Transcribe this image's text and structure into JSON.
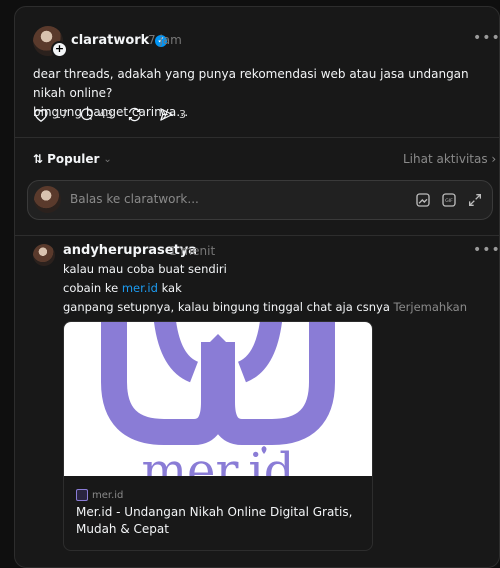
{
  "post": {
    "username": "claratwork",
    "time": "7 jam",
    "text_line1": "dear threads, adakah yang punya rekomendasi web atau jasa undangan nikah online?",
    "text_line2": "bingung banget carinya…",
    "likes": "17",
    "comments": "43",
    "shares": "3"
  },
  "sort": {
    "label": "Populer",
    "activity": "Lihat aktivitas"
  },
  "reply_box": {
    "placeholder": "Balas ke claratwork..."
  },
  "reply": {
    "username": "andyheruprasetya",
    "time": "1 menit",
    "line1": "kalau mau coba buat sendiri",
    "line2_prefix": "cobain ke ",
    "line2_link": "mer.id",
    "line2_suffix": " kak",
    "line3": "ganpang setupnya, kalau bingung tinggal chat aja csnya",
    "translate": "Terjemahkan",
    "card": {
      "domain": "mer.id",
      "title": "Mer.id - Undangan Nikah Online Digital Gratis, Mudah & Cepat",
      "image_text": "mer.id"
    }
  },
  "colors": {
    "background": "#0f0f0f",
    "panel": "#181818",
    "link": "#1d9bf0",
    "verified": "#0095f6",
    "brand_purple": "#8a7cd6"
  },
  "icons": [
    "heart-icon",
    "comment-icon",
    "repost-icon",
    "share-icon",
    "more-icon",
    "sort-icon",
    "chevron-down-icon",
    "chevron-right-icon",
    "image-icon",
    "gif-icon",
    "expand-icon",
    "verified-icon",
    "plus-icon",
    "site-favicon"
  ]
}
